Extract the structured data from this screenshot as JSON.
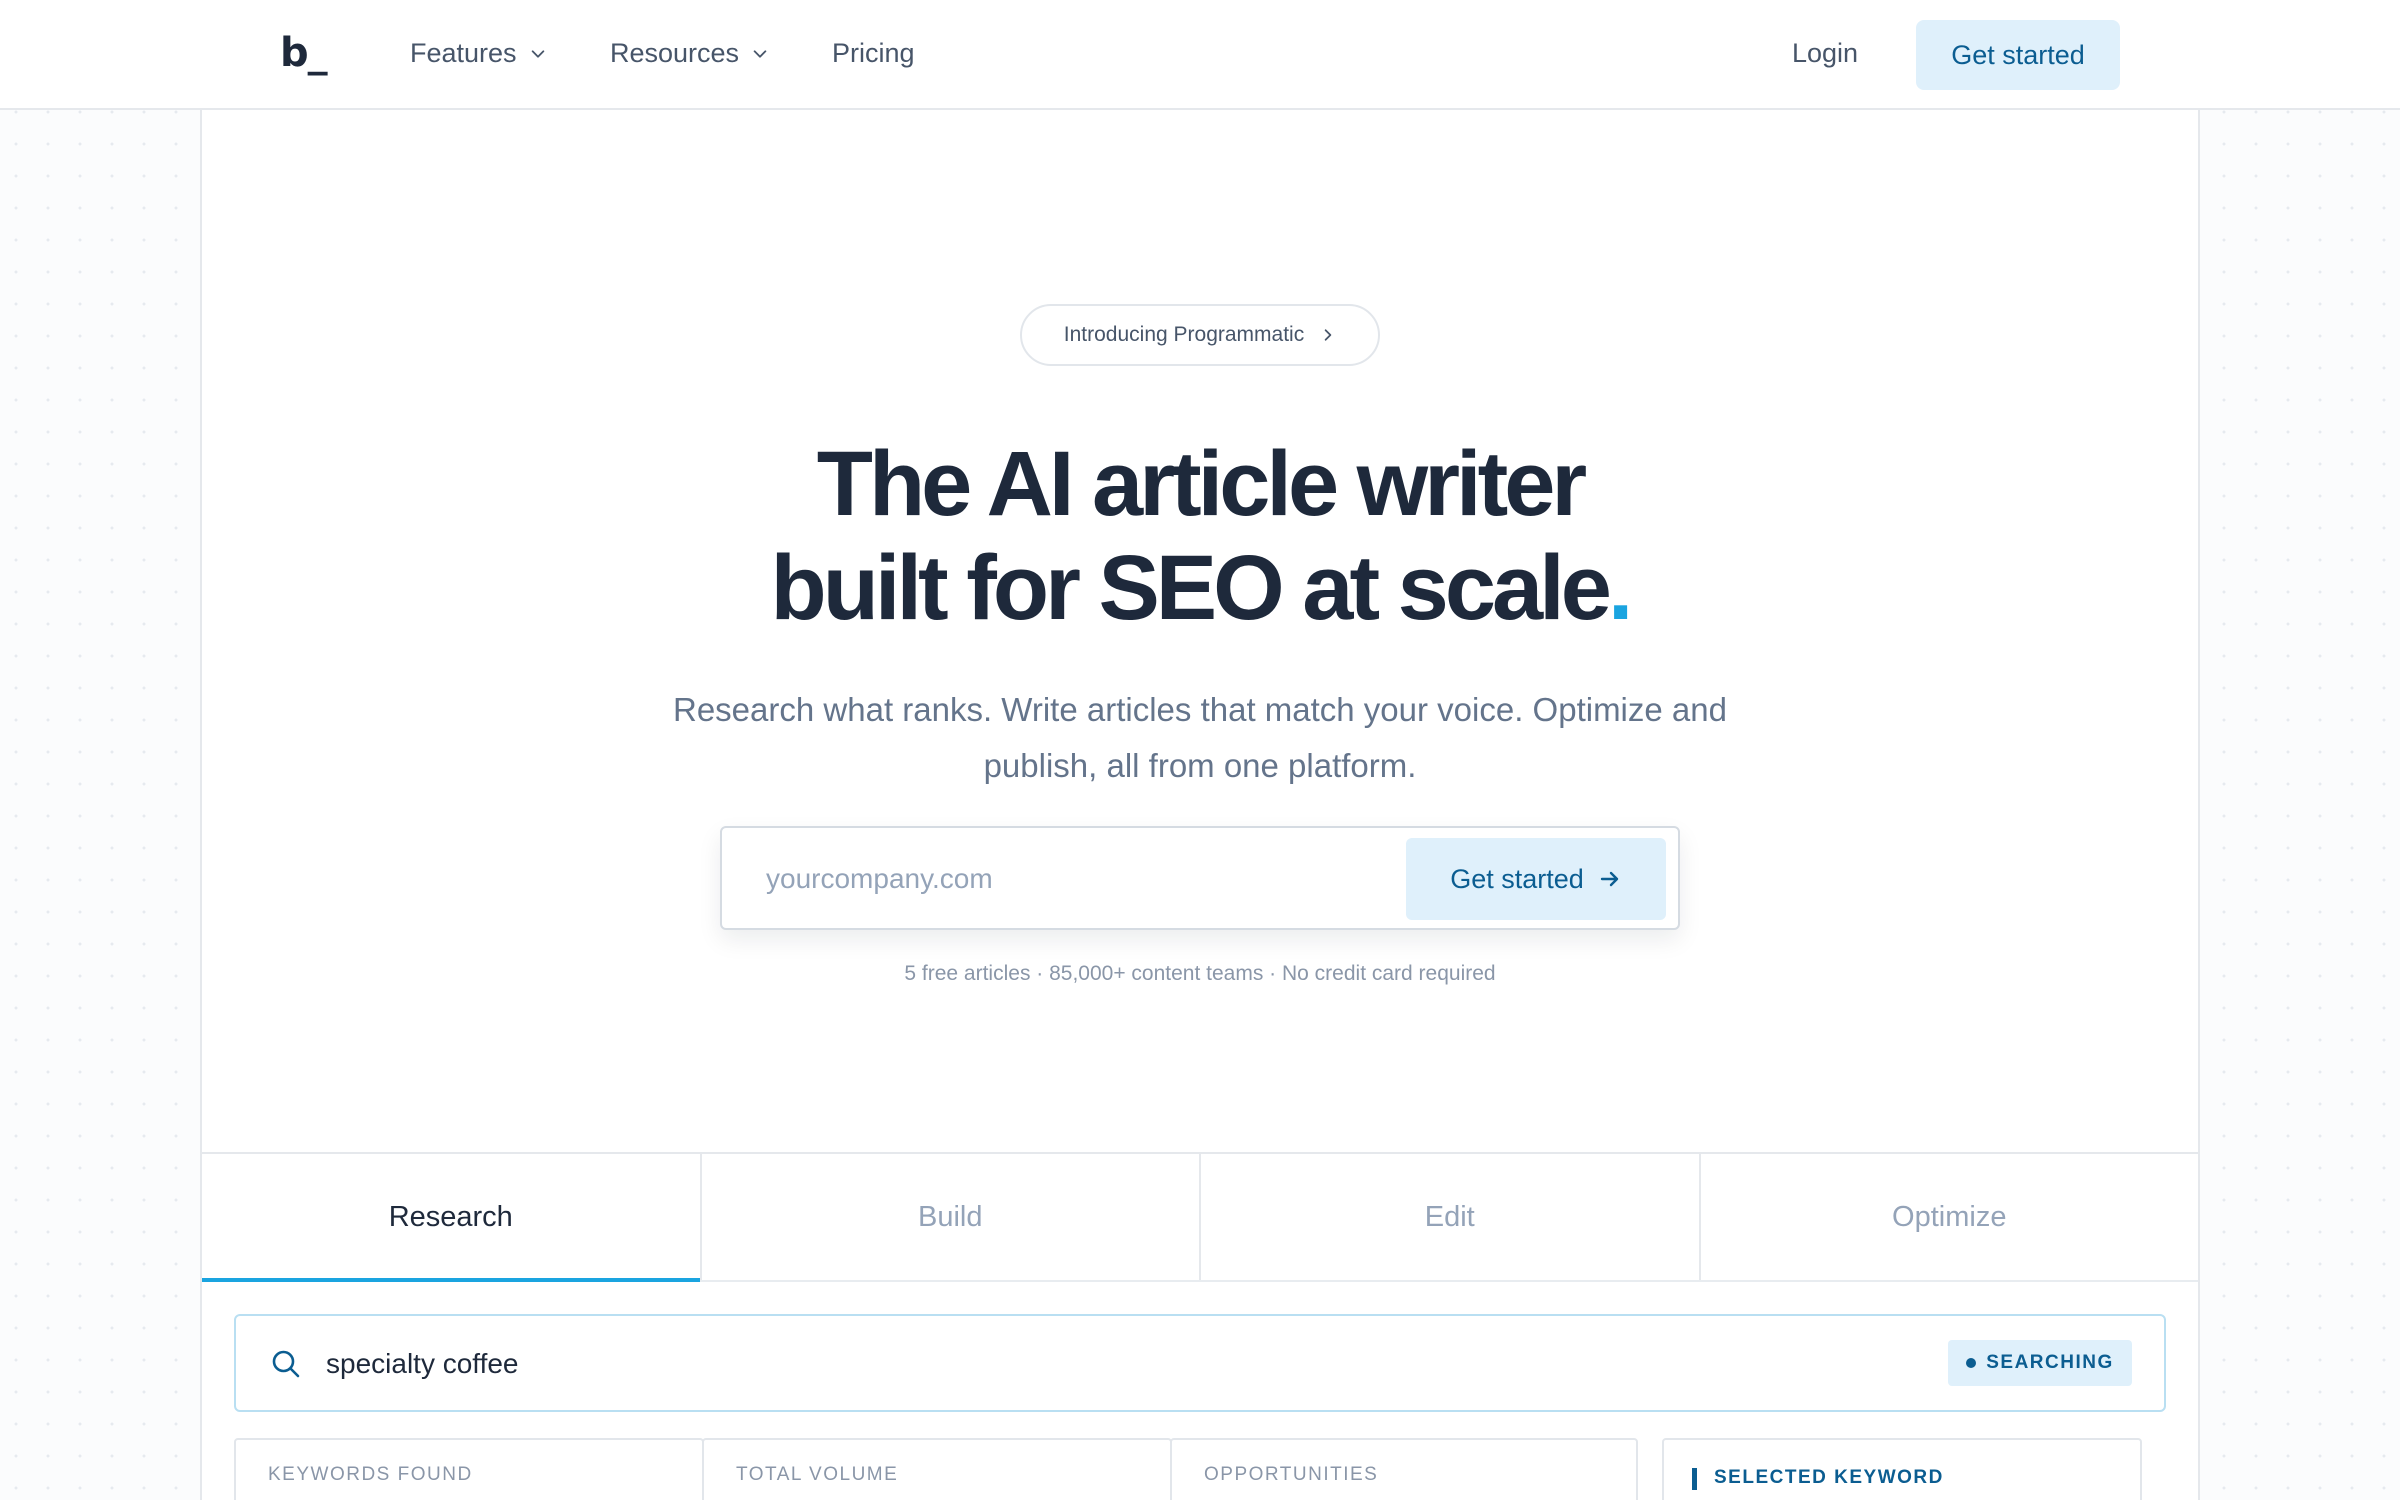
{
  "nav": {
    "logo": "b_",
    "links": [
      {
        "label": "Features",
        "has_dropdown": true
      },
      {
        "label": "Resources",
        "has_dropdown": true
      },
      {
        "label": "Pricing",
        "has_dropdown": false
      }
    ],
    "login_label": "Login",
    "cta_label": "Get started"
  },
  "hero": {
    "announcement": "Introducing Programmatic",
    "headline_line1": "The AI article writer",
    "headline_line2": "built for SEO at scale",
    "headline_dot": ".",
    "subtitle_line1": "Research what ranks. Write articles that match your voice. Optimize and",
    "subtitle_line2": "publish, all from one platform.",
    "domain_placeholder": "yourcompany.com",
    "cta_label": "Get started",
    "fine_print": "5 free articles · 85,000+ content teams · No credit card required"
  },
  "tabs": [
    {
      "label": "Research",
      "active": true
    },
    {
      "label": "Build",
      "active": false
    },
    {
      "label": "Edit",
      "active": false
    },
    {
      "label": "Optimize",
      "active": false
    }
  ],
  "research": {
    "query": "specialty coffee",
    "status": "SEARCHING",
    "stats": [
      "KEYWORDS FOUND",
      "TOTAL VOLUME",
      "OPPORTUNITIES"
    ],
    "selected_keyword_label": "SELECTED KEYWORD"
  },
  "colors": {
    "accent": "#1aa4e0",
    "cta_bg": "#dff0fb",
    "cta_text": "#0b5d91",
    "headline": "#1e293b"
  }
}
